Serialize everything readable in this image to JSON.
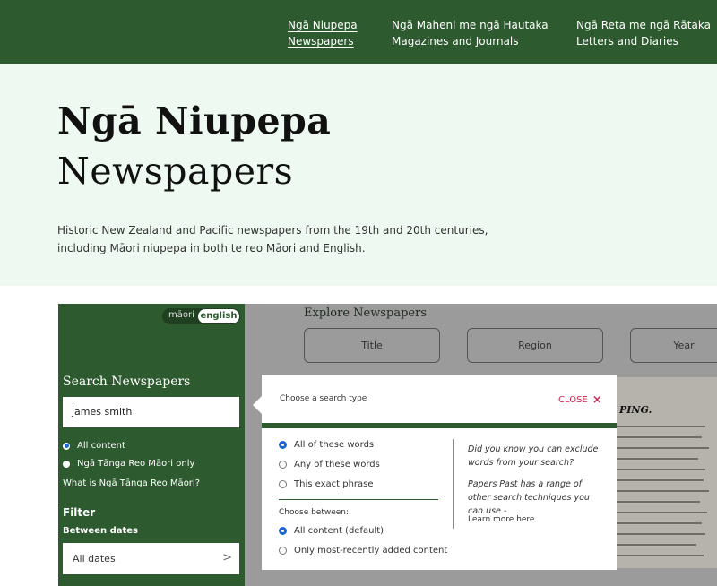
{
  "nav": {
    "items": [
      {
        "label_mi": "Ngā Niupepa",
        "label_en": "Newspapers"
      },
      {
        "label_mi": "Ngā Maheni me ngā Hautaka",
        "label_en": "Magazines and Journals"
      },
      {
        "label_mi": "Ngā Reta me ngā Rātaka",
        "label_en": "Letters and Diaries"
      }
    ]
  },
  "hero": {
    "title_mi": "Ngā Niupepa",
    "title_en": "Newspapers",
    "description": "Historic New Zealand and Pacific newspapers from the 19th and 20th centuries, including Māori niupepa in both te reo Māori and English."
  },
  "sidebar": {
    "lang_mi": "māori",
    "lang_en": "english",
    "search_heading": "Search Newspapers",
    "search_value": "james smith",
    "radio_all": "All content",
    "radio_maori": "Ngā Tānga Reo Māori only",
    "what_link": "What is Ngā Tānga Reo Māori?",
    "filter_heading": "Filter",
    "between_label": "Between dates",
    "dates_value": "All dates",
    "chevron": ">"
  },
  "explore": {
    "heading": "Explore Newspapers",
    "buttons": [
      "Title",
      "Region",
      "Year"
    ],
    "scrap_title": "PING."
  },
  "popup": {
    "title": "Choose a search type",
    "close_label": "CLOSE",
    "close_icon": "×",
    "search_types": [
      "All of these words",
      "Any of these words",
      "This exact phrase"
    ],
    "choose_label": "Choose between:",
    "content_types": [
      "All content (default)",
      "Only most-recently added content"
    ],
    "tip_1": "Did you know you can exclude words from your search?",
    "tip_2": "Papers Past has a range of other search techniques you can use -",
    "learn_more": "Learn more here"
  },
  "colors": {
    "brand_green": "#2d5a2e",
    "hero_bg": "#eefaf1",
    "close_red": "#c7254e",
    "radio_blue": "#1e66d0"
  }
}
